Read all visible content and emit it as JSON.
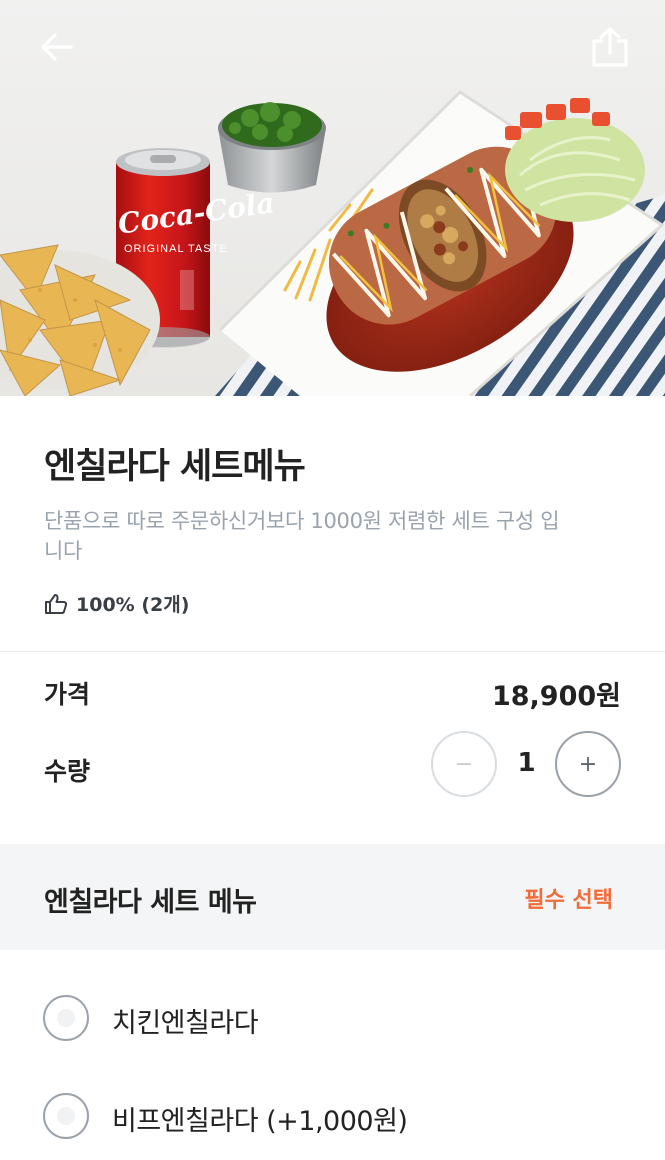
{
  "hero": {
    "photo_description": "burrito-set-food-photo",
    "can_brand": "Coca-Cola",
    "can_subtext": "ORIGINAL TASTE"
  },
  "nav": {
    "back_icon": "arrow-left-icon",
    "share_icon": "share-icon"
  },
  "product": {
    "title": "엔칠라다 세트메뉴",
    "description": "단품으로 따로 주문하신거보다 1000원 저렴한 세트 구성 입니다",
    "likes_icon": "thumbs-up-icon",
    "likes_text": "100% (2개)"
  },
  "price": {
    "label": "가격",
    "value": "18,900원"
  },
  "quantity": {
    "label": "수량",
    "value": "1",
    "minus_symbol": "−",
    "plus_symbol": "+"
  },
  "option_group": {
    "title": "엔칠라다 세트 메뉴",
    "required_label": "필수 선택",
    "options": [
      {
        "label": "치킨엔칠라다",
        "selected": false
      },
      {
        "label": "비프엔칠라다 (+1,000원)",
        "selected": false
      }
    ]
  },
  "colors": {
    "accent": "#f26b3a",
    "muted_text": "#9aa3ad",
    "section_bg": "#f4f5f6"
  }
}
